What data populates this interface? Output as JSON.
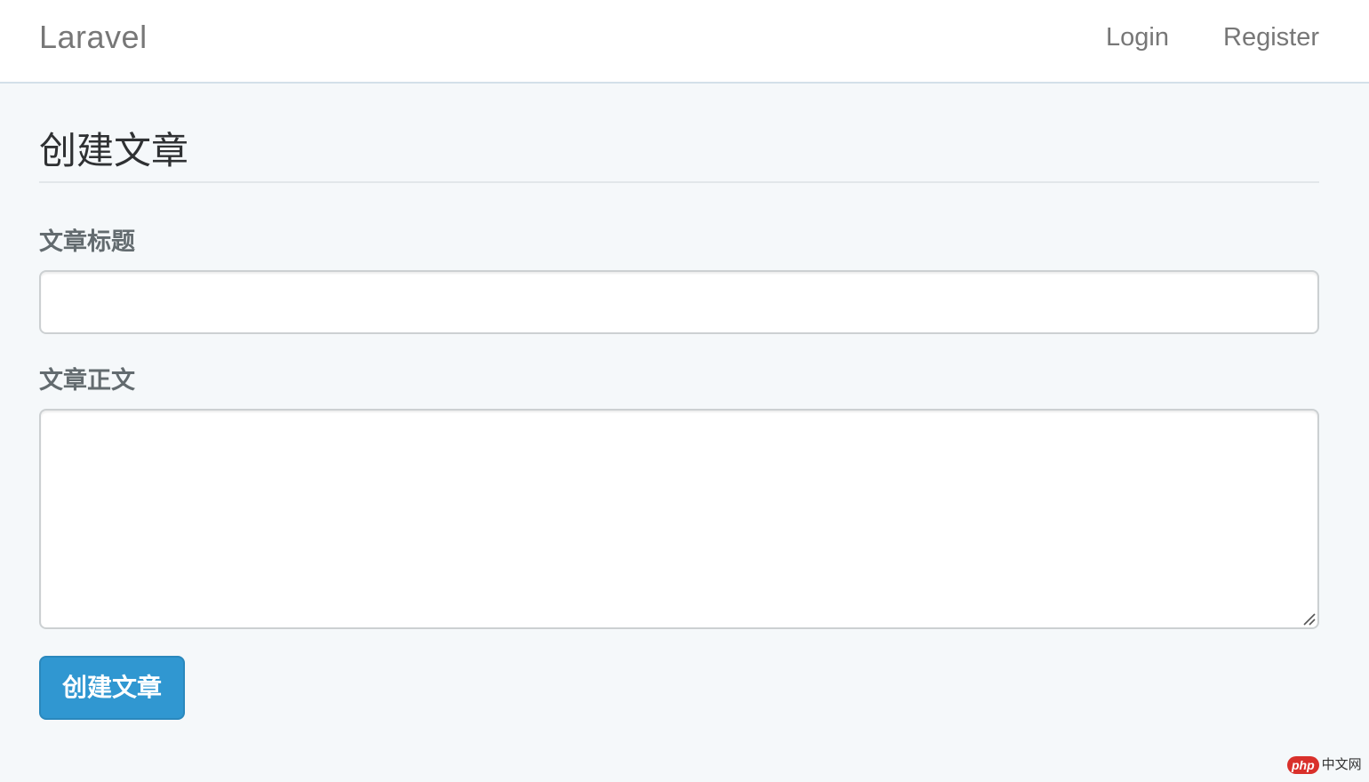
{
  "navbar": {
    "brand": "Laravel",
    "links": {
      "login": "Login",
      "register": "Register"
    }
  },
  "page": {
    "title": "创建文章"
  },
  "form": {
    "title_label": "文章标题",
    "title_value": "",
    "body_label": "文章正文",
    "body_value": "",
    "submit_label": "创建文章"
  },
  "watermark": {
    "badge": "php",
    "text": "中文网"
  },
  "colors": {
    "background": "#f5f8fa",
    "primary_button": "#3097d1",
    "navbar_border": "#d3e0e9"
  },
  "icons": {
    "resize_grip": "resize-grip-icon"
  }
}
